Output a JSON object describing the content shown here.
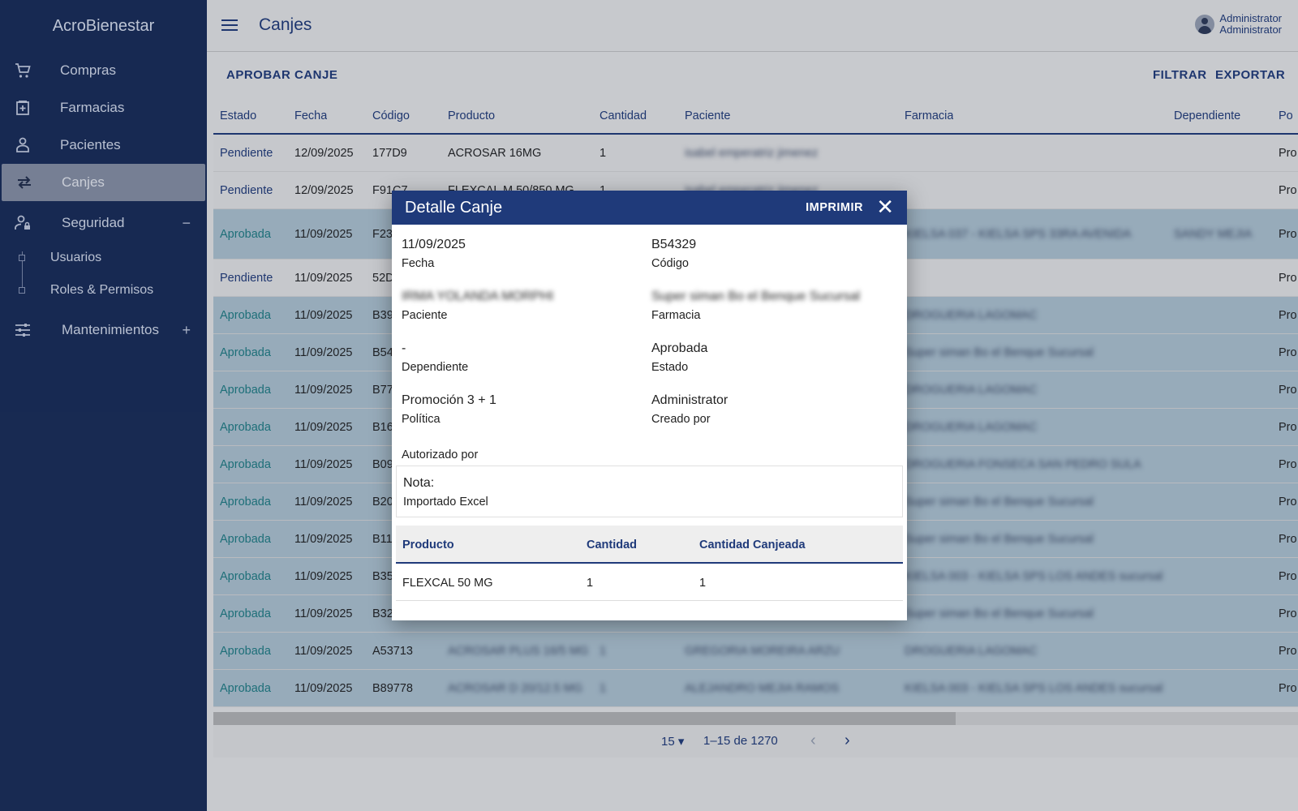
{
  "app": {
    "brand": "AcroBienestar"
  },
  "sidebar": {
    "items": [
      {
        "label": "Compras",
        "icon": "cart-icon"
      },
      {
        "label": "Farmacias",
        "icon": "pharmacy-icon"
      },
      {
        "label": "Pacientes",
        "icon": "patient-icon"
      },
      {
        "label": "Canjes",
        "icon": "swap-icon",
        "active": true
      },
      {
        "label": "Seguridad",
        "icon": "user-lock-icon",
        "toggle": "−"
      },
      {
        "label": "Mantenimientos",
        "icon": "sliders-icon",
        "toggle": "+"
      }
    ],
    "security_sub": [
      "Usuarios",
      "Roles & Permisos"
    ]
  },
  "header": {
    "title": "Canjes",
    "user_line1": "Administrator",
    "user_line2": "Administrator"
  },
  "actions": {
    "approve": "APROBAR CANJE",
    "filter": "FILTRAR",
    "export": "EXPORTAR"
  },
  "table": {
    "columns": [
      "Estado",
      "Fecha",
      "Código",
      "Producto",
      "Cantidad",
      "Paciente",
      "Farmacia",
      "Dependiente",
      "Po"
    ],
    "rows": [
      {
        "estado": "Pendiente",
        "fecha": "12/09/2025",
        "codigo": "177D9",
        "producto": "ACROSAR 16MG",
        "cantidad": "1",
        "paciente": "isabel emperatriz jimenez",
        "farmacia": "",
        "dependiente": "",
        "po": "Pro"
      },
      {
        "estado": "Pendiente",
        "fecha": "12/09/2025",
        "codigo": "F91C7",
        "producto": "FLEXCAL M 50/850 MG",
        "cantidad": "1",
        "paciente": "isabel emperatriz jimenez",
        "farmacia": "",
        "dependiente": "",
        "po": "Pro"
      },
      {
        "estado": "Aprobada",
        "fecha": "11/09/2025",
        "codigo": "F23",
        "producto": "",
        "cantidad": "",
        "paciente": "",
        "farmacia": "KIELSA 037 - KIELSA SPS 33RA AVENIDA",
        "dependiente": "SANDY MEJIA",
        "po": "Pro"
      },
      {
        "estado": "Pendiente",
        "fecha": "11/09/2025",
        "codigo": "52D",
        "producto": "",
        "cantidad": "",
        "paciente": "",
        "farmacia": "",
        "dependiente": "",
        "po": "Pro"
      },
      {
        "estado": "Aprobada",
        "fecha": "11/09/2025",
        "codigo": "B39",
        "producto": "",
        "cantidad": "",
        "paciente": "",
        "farmacia": "DROGUERIA LAGOMAC",
        "dependiente": "",
        "po": "Pro"
      },
      {
        "estado": "Aprobada",
        "fecha": "11/09/2025",
        "codigo": "B54",
        "producto": "",
        "cantidad": "",
        "paciente": "",
        "farmacia": "Super siman Bo el Benque Sucursal",
        "dependiente": "",
        "po": "Pro"
      },
      {
        "estado": "Aprobada",
        "fecha": "11/09/2025",
        "codigo": "B77",
        "producto": "",
        "cantidad": "",
        "paciente": "",
        "farmacia": "DROGUERIA LAGOMAC",
        "dependiente": "",
        "po": "Pro"
      },
      {
        "estado": "Aprobada",
        "fecha": "11/09/2025",
        "codigo": "B16",
        "producto": "",
        "cantidad": "",
        "paciente": "",
        "farmacia": "DROGUERIA LAGOMAC",
        "dependiente": "",
        "po": "Pro"
      },
      {
        "estado": "Aprobada",
        "fecha": "11/09/2025",
        "codigo": "B09",
        "producto": "",
        "cantidad": "",
        "paciente": "",
        "farmacia": "DROGUERIA FONSECA SAN PEDRO SULA",
        "dependiente": "",
        "po": "Pro"
      },
      {
        "estado": "Aprobada",
        "fecha": "11/09/2025",
        "codigo": "B20",
        "producto": "",
        "cantidad": "",
        "paciente": "",
        "farmacia": "Super siman Bo el Benque Sucursal",
        "dependiente": "",
        "po": "Pro"
      },
      {
        "estado": "Aprobada",
        "fecha": "11/09/2025",
        "codigo": "B11",
        "producto": "",
        "cantidad": "",
        "paciente": "",
        "farmacia": "Super siman Bo el Benque Sucursal",
        "dependiente": "",
        "po": "Pro"
      },
      {
        "estado": "Aprobada",
        "fecha": "11/09/2025",
        "codigo": "B35",
        "producto": "",
        "cantidad": "",
        "paciente": "",
        "farmacia": "KIELSA 003 - KIELSA SPS LOS ANDES sucursal",
        "dependiente": "",
        "po": "Pro"
      },
      {
        "estado": "Aprobada",
        "fecha": "11/09/2025",
        "codigo": "B32",
        "producto": "",
        "cantidad": "",
        "paciente": "",
        "farmacia": "Super siman Bo el Benque Sucursal",
        "dependiente": "",
        "po": "Pro"
      },
      {
        "estado": "Aprobada",
        "fecha": "11/09/2025",
        "codigo": "A53713",
        "producto": "ACROSAR PLUS 16/5 MG",
        "cantidad": "1",
        "paciente": "GREGORIA MOREIRA ARZU",
        "farmacia": "DROGUERIA LAGOMAC",
        "dependiente": "",
        "po": "Pro"
      },
      {
        "estado": "Aprobada",
        "fecha": "11/09/2025",
        "codigo": "B89778",
        "producto": "ACROSAR D 20/12.5 MG",
        "cantidad": "1",
        "paciente": "ALEJANDRO MEJIA RAMOS",
        "farmacia": "KIELSA 003 - KIELSA SPS LOS ANDES sucursal",
        "dependiente": "",
        "po": "Pro"
      }
    ]
  },
  "pager": {
    "per_page": "15 ▾",
    "range": "1–15 de 1270",
    "prev": "‹",
    "next": "›"
  },
  "dialog": {
    "title": "Detalle Canje",
    "print": "IMPRIMIR",
    "close": "✕",
    "fecha_value": "11/09/2025",
    "fecha_label": "Fecha",
    "codigo_value": "B54329",
    "codigo_label": "Código",
    "paciente_value": "IRMA YOLANDA MORPHI",
    "paciente_label": "Paciente",
    "farmacia_value": "Super siman Bo el Benque Sucursal",
    "farmacia_label": "Farmacia",
    "dependiente_value": "-",
    "dependiente_label": "Dependiente",
    "estado_value": "Aprobada",
    "estado_label": "Estado",
    "politica_value": "Promoción 3 + 1",
    "politica_label": "Política",
    "creado_value": "Administrator",
    "creado_label": "Creado por",
    "autorizado_label": "Autorizado por",
    "nota_title": "Nota:",
    "nota_value": "Importado Excel",
    "product_columns": [
      "Producto",
      "Cantidad",
      "Cantidad Canjeada"
    ],
    "products": [
      {
        "producto": "FLEXCAL 50 MG",
        "cantidad": "1",
        "canjeada": "1"
      }
    ]
  },
  "colors": {
    "sidebar": "#172a57",
    "primary": "#1f3a7a",
    "approved_row": "#b2c8d6",
    "approved_text": "#1e7f86"
  }
}
